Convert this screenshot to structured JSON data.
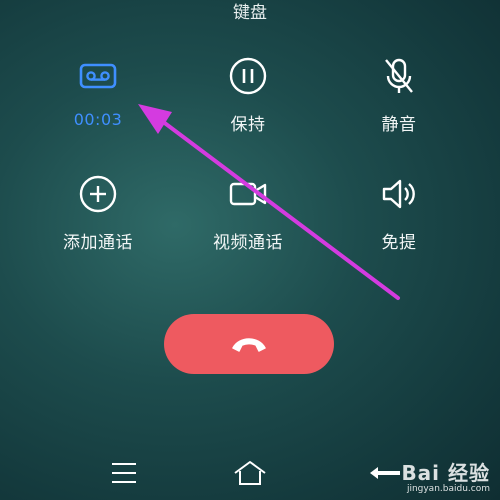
{
  "top_label": "键盘",
  "controls": {
    "record": {
      "label": "00:03",
      "icon": "voicemail-record-icon",
      "color": "#3f8fff"
    },
    "hold": {
      "label": "保持",
      "icon": "pause-circle-icon"
    },
    "mute": {
      "label": "静音",
      "icon": "microphone-off-icon"
    },
    "add_call": {
      "label": "添加通话",
      "icon": "plus-circle-icon"
    },
    "video_call": {
      "label": "视频通话",
      "icon": "video-camera-icon"
    },
    "speaker": {
      "label": "免提",
      "icon": "speaker-icon"
    }
  },
  "hangup": {
    "icon": "phone-hangup-icon",
    "color": "#ee5a60"
  },
  "nav": {
    "menu_icon": "menu-icon",
    "home_icon": "home-icon",
    "back_icon": "back-icon"
  },
  "annotation": {
    "arrow_color": "#d43be0"
  },
  "watermark": {
    "main": "Bai 经验",
    "url": "jingyan.baidu.com"
  }
}
